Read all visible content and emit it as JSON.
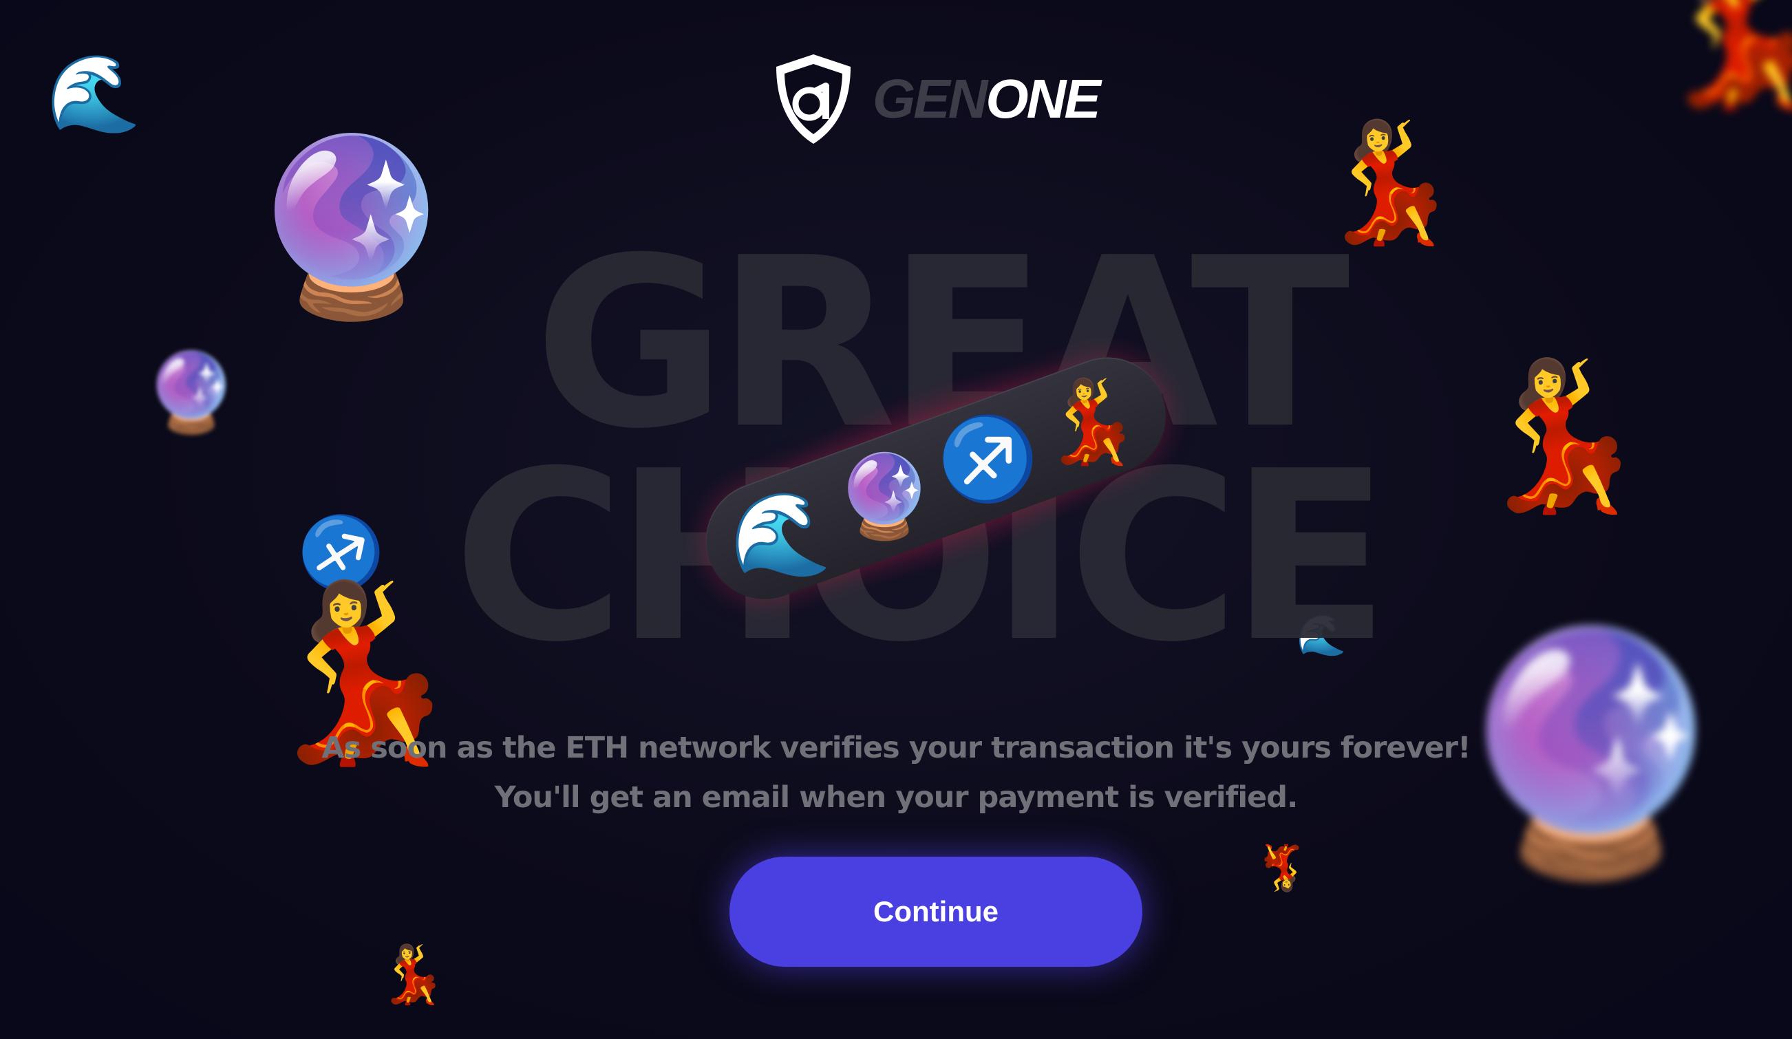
{
  "brand": {
    "icon": "genone-shield-logo-icon",
    "name_part1": "GEN",
    "name_part2": "ONE",
    "color_dim": "#3d3d4a",
    "color_bright": "#ffffff"
  },
  "headline": {
    "line1": "GREAT",
    "line2": "CHOICE"
  },
  "selection_pill": {
    "emojis": [
      "🌊",
      "🔮",
      "♐",
      "💃"
    ]
  },
  "message": {
    "line1": "As soon as the ETH network verifies your transaction it's yours forever!",
    "line2": "You'll get an email when your payment is verified."
  },
  "continue_button": {
    "label": "Continue",
    "color": "#4a3fe0"
  },
  "floating_emojis": {
    "wave": "🌊",
    "crystal_ball": "🔮",
    "sagittarius": "♐",
    "dancer": "💃"
  }
}
